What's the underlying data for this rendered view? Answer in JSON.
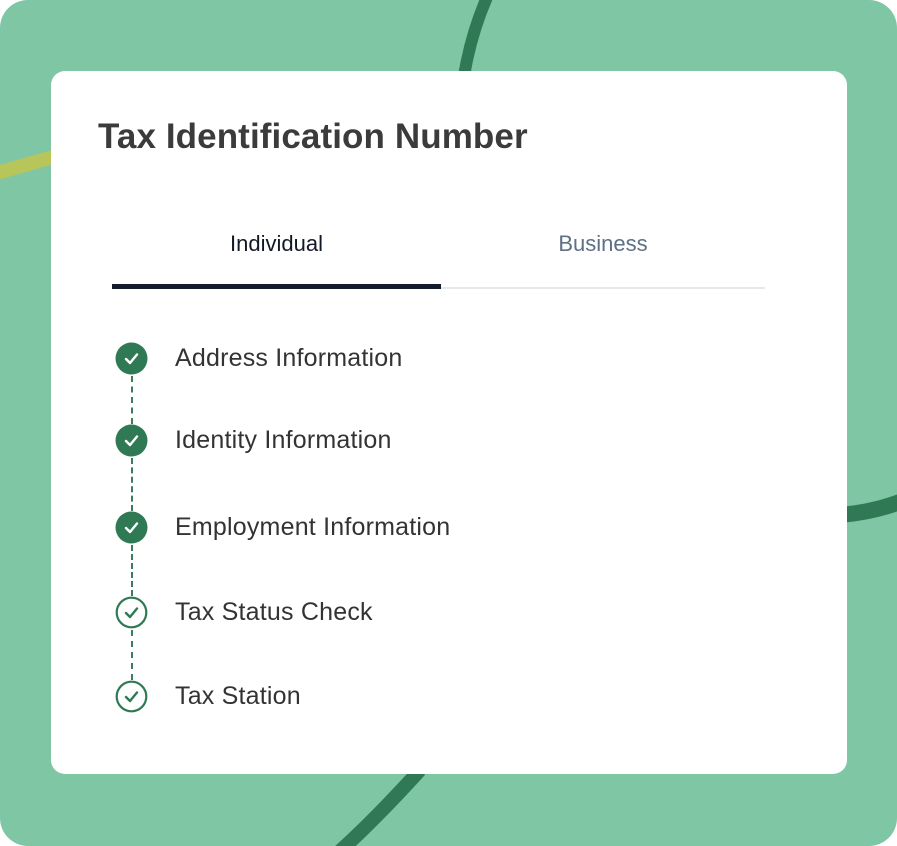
{
  "colors": {
    "background": "#7fc6a4",
    "accent_dark_green": "#2f7a55",
    "accent_olive": "#b8c55a",
    "tab_indicator": "#141c2e"
  },
  "card": {
    "title": "Tax Identification Number"
  },
  "tabs": [
    {
      "label": "Individual",
      "selected": true
    },
    {
      "label": "Business",
      "selected": false
    }
  ],
  "steps": [
    {
      "label": "Address Information",
      "status": "completed",
      "icon": "check-circle-filled-icon"
    },
    {
      "label": "Identity Information",
      "status": "completed",
      "icon": "check-circle-filled-icon"
    },
    {
      "label": "Employment Information",
      "status": "completed",
      "icon": "check-circle-filled-icon"
    },
    {
      "label": "Tax Status Check",
      "status": "pending",
      "icon": "check-circle-outline-icon"
    },
    {
      "label": "Tax Station",
      "status": "pending",
      "icon": "check-circle-outline-icon"
    }
  ]
}
